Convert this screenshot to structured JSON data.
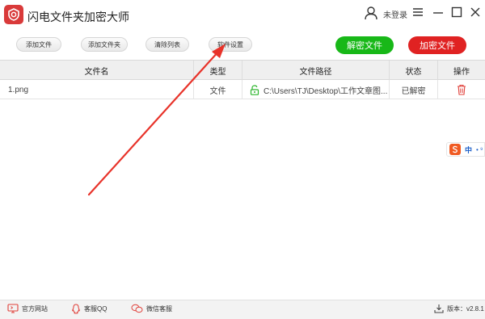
{
  "app": {
    "title": "闪电文件夹加密大师",
    "login_label": "未登录"
  },
  "toolbar": {
    "add_file": "添加文件",
    "add_folder": "添加文件夹",
    "clear_list": "清除列表",
    "settings": "软件设置",
    "decrypt": "解密文件",
    "encrypt": "加密文件"
  },
  "table": {
    "headers": {
      "name": "文件名",
      "type": "类型",
      "path": "文件路径",
      "status": "状态",
      "action": "操作"
    },
    "rows": [
      {
        "name": "1.png",
        "type": "文件",
        "path": "C:\\Users\\TJ\\Desktop\\工作文章图...",
        "status": "已解密"
      }
    ]
  },
  "ime": {
    "label": "中"
  },
  "footer": {
    "website": "官方网站",
    "qq": "客服QQ",
    "wechat": "微信客服",
    "version": "版本：v2.8.1"
  },
  "colors": {
    "brand_red": "#d93a3a",
    "decrypt_green": "#18b818",
    "encrypt_red": "#e02222",
    "arrow_red": "#e8332a",
    "unlock_green": "#2cb52c"
  },
  "icons": {
    "logo": "app-logo-icon",
    "user": "user-icon",
    "menu": "menu-icon",
    "minimize": "minimize-icon",
    "maximize": "maximize-icon",
    "close": "close-icon",
    "unlock": "unlock-icon",
    "delete": "trash-icon",
    "website": "monitor-icon",
    "qq": "qq-icon",
    "wechat": "wechat-icon",
    "download": "download-icon"
  }
}
